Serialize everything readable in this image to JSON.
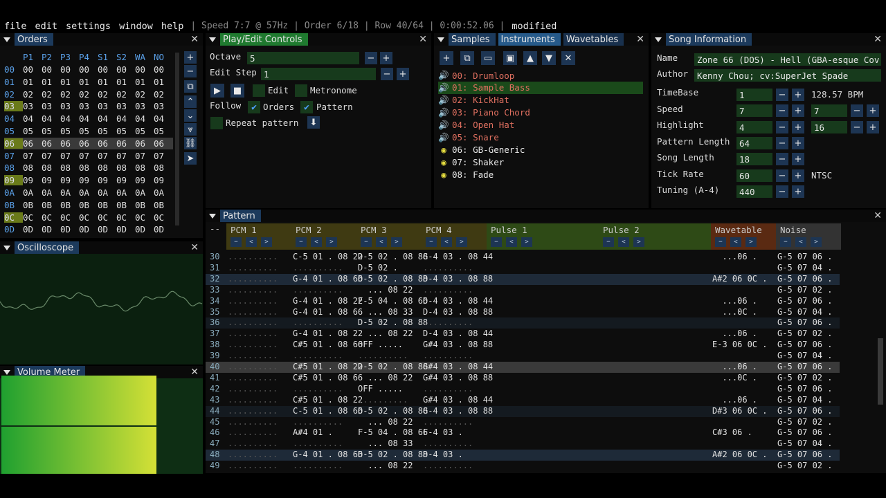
{
  "menu": {
    "items": [
      "file",
      "edit",
      "settings",
      "window",
      "help"
    ],
    "status": "| Speed 7:7 @ 57Hz | Order 6/18 | Row 40/64 | 0:00:52.06 |",
    "modified": "modified"
  },
  "orders": {
    "title": "Orders",
    "headers": [
      "P1",
      "P2",
      "P3",
      "P4",
      "S1",
      "S2",
      "WA",
      "NO"
    ],
    "rows": [
      "00",
      "01",
      "02",
      "03",
      "04",
      "05",
      "06",
      "07",
      "08",
      "09",
      "0A",
      "0B",
      "0C",
      "0D"
    ]
  },
  "playctl": {
    "title": "Play/Edit Controls",
    "octave_label": "Octave",
    "octave": "5",
    "step_label": "Edit Step",
    "step": "1",
    "edit": "Edit",
    "metronome": "Metronome",
    "follow": "Follow",
    "orders": "Orders",
    "pattern": "Pattern",
    "repeat": "Repeat pattern"
  },
  "samples": {
    "tabs": [
      "Samples",
      "Instruments",
      "Wavetables"
    ],
    "list": [
      {
        "name": "00: Drumloop",
        "kind": "pcm"
      },
      {
        "name": "01: Sample Bass",
        "kind": "pcm"
      },
      {
        "name": "02: KickHat",
        "kind": "pcm"
      },
      {
        "name": "03: Piano Chord",
        "kind": "pcm"
      },
      {
        "name": "04: Open Hat",
        "kind": "pcm"
      },
      {
        "name": "05: Snare",
        "kind": "pcm"
      },
      {
        "name": "06: GB-Generic",
        "kind": "gb"
      },
      {
        "name": "07: Shaker",
        "kind": "gb"
      },
      {
        "name": "08: Fade",
        "kind": "gb"
      }
    ]
  },
  "song": {
    "title": "Song Information",
    "name_label": "Name",
    "name": "Zone 66 (DOS) - Hell (GBA-esque Cov",
    "author_label": "Author",
    "author": "Kenny Chou; cv:SuperJet Spade",
    "timebase_label": "TimeBase",
    "timebase": "1",
    "bpm": "128.57 BPM",
    "speed_label": "Speed",
    "speed1": "7",
    "speed2": "7",
    "highlight_label": "Highlight",
    "hl1": "4",
    "hl2": "16",
    "patlen_label": "Pattern Length",
    "patlen": "64",
    "songlen_label": "Song Length",
    "songlen": "18",
    "tick_label": "Tick Rate",
    "tick": "60",
    "ntsc": "NTSC",
    "tuning_label": "Tuning (A-4)",
    "tuning": "440"
  },
  "osc": {
    "title": "Oscilloscope"
  },
  "vol": {
    "title": "Volume Meter",
    "level": 0.95
  },
  "pattern": {
    "title": "Pattern",
    "corner": "--",
    "channels": [
      "PCM 1",
      "PCM 2",
      "PCM 3",
      "PCM 4",
      "Pulse 1",
      "Pulse 2",
      "Wavetable",
      "Noise"
    ],
    "colors": {
      "pcm": "#3f3a12",
      "pulse": "#2e4a16",
      "wave": "#5a2a12",
      "noise": "#333"
    },
    "rows": [
      {
        "n": "30",
        "c": [
          "..........",
          "C-5 01 . 08 22",
          "D-5 02 . 08 88",
          "G-4 03 . 08 44",
          "",
          "",
          "  ...06 .",
          "G-5 07 06 ."
        ]
      },
      {
        "n": "31",
        "c": [
          "..........",
          "..........",
          "D-5 02 .",
          "..........",
          "",
          "",
          "",
          "G-5 07 04 ."
        ]
      },
      {
        "n": "32",
        "c": [
          "..........",
          "G-4 01 . 08 66",
          "D-5 02 . 08 88",
          "D-4 03 . 08 88",
          "",
          "",
          "A#2 06 0C .",
          "G-5 07 06 ."
        ]
      },
      {
        "n": "33",
        "c": [
          "..........",
          "..........",
          "  ... 08 22",
          "..........",
          "",
          "",
          "",
          "G-5 07 02 ."
        ]
      },
      {
        "n": "34",
        "c": [
          "..........",
          "G-4 01 . 08 22",
          "F-5 04 . 08 66",
          "D-4 03 . 08 44",
          "",
          "",
          "  ...06 .",
          "G-5 07 06 ."
        ]
      },
      {
        "n": "35",
        "c": [
          "..........",
          "G-4 01 . 08 66",
          "  ... 08 33",
          "D-4 03 . 08 88",
          "",
          "",
          "  ...0C .",
          "G-5 07 04 ."
        ]
      },
      {
        "n": "36",
        "c": [
          "..........",
          "..........",
          "D-5 02 . 08 88",
          "..........",
          "",
          "",
          "",
          "G-5 07 06 ."
        ]
      },
      {
        "n": "37",
        "c": [
          "..........",
          "G-4 01 . 08 22",
          "  ... 08 22",
          "D-4 03 . 08 44",
          "",
          "",
          "  ...06 .",
          "G-5 07 02 ."
        ]
      },
      {
        "n": "38",
        "c": [
          "..........",
          "C#5 01 . 08 66",
          "OFF .....",
          "G#4 03 . 08 88",
          "",
          "",
          "E-3 06 0C .",
          "G-5 07 06 ."
        ]
      },
      {
        "n": "39",
        "c": [
          "..........",
          "..........",
          "..........",
          "..........",
          "",
          "",
          "",
          "G-5 07 04 ."
        ]
      },
      {
        "n": "40",
        "c": [
          "..........",
          "C#5 01 . 08 22",
          "D-5 02 . 08 88",
          "G#4 03 . 08 44",
          "",
          "",
          "  ...06 .",
          "G-5 07 06 ."
        ]
      },
      {
        "n": "41",
        "c": [
          "..........",
          "C#5 01 . 08 66",
          "  ... 08 22",
          "G#4 03 . 08 88",
          "",
          "",
          "  ...0C .",
          "G-5 07 02 ."
        ]
      },
      {
        "n": "42",
        "c": [
          "..........",
          "..........",
          "OFF .....",
          "..........",
          "",
          "",
          "",
          "G-5 07 06 ."
        ]
      },
      {
        "n": "43",
        "c": [
          "..........",
          "C#5 01 . 08 22",
          "..........",
          "G#4 03 . 08 44",
          "",
          "",
          "  ...06 .",
          "G-5 07 04 ."
        ]
      },
      {
        "n": "44",
        "c": [
          "..........",
          "C-5 01 . 08 66",
          "D-5 02 . 08 88",
          "G-4 03 . 08 88",
          "",
          "",
          "D#3 06 0C .",
          "G-5 07 06 ."
        ]
      },
      {
        "n": "45",
        "c": [
          "..........",
          "..........",
          "  ... 08 22",
          "..........",
          "",
          "",
          "",
          "G-5 07 02 ."
        ]
      },
      {
        "n": "46",
        "c": [
          "..........",
          "A#4 01 .",
          "F-5 04 . 08 66",
          "F-4 03 .",
          "",
          "",
          "C#3 06 .",
          "G-5 07 06 ."
        ]
      },
      {
        "n": "47",
        "c": [
          "..........",
          "..........",
          "  ... 08 33",
          "..........",
          "",
          "",
          "",
          "G-5 07 04 ."
        ]
      },
      {
        "n": "48",
        "c": [
          "..........",
          "G-4 01 . 08 66",
          "D-5 02 . 08 88",
          "D-4 03 .",
          "",
          "",
          "A#2 06 0C .",
          "G-5 07 06 ."
        ]
      },
      {
        "n": "49",
        "c": [
          "..........",
          "..........",
          "  ... 08 22",
          "..........",
          "",
          "",
          "",
          "G-5 07 02 ."
        ]
      }
    ]
  }
}
